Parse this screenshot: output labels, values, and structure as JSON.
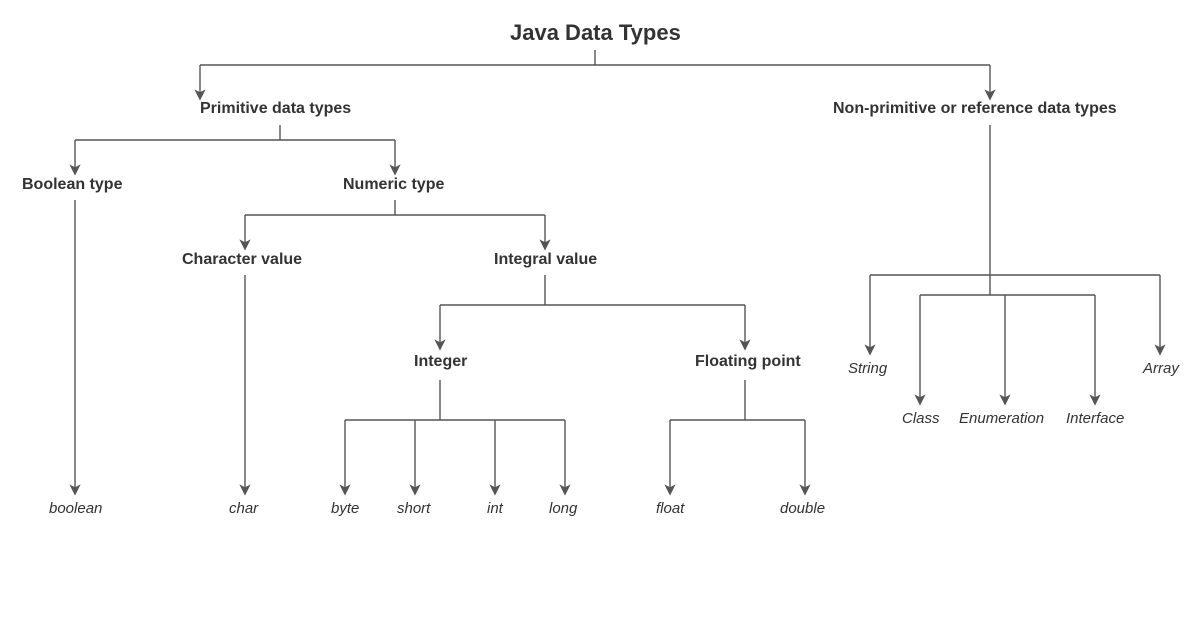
{
  "title": "Java Data Types",
  "tree": {
    "primitive": {
      "label": "Primitive data types",
      "boolean_type": {
        "label": "Boolean type",
        "boolean": "boolean"
      },
      "numeric_type": {
        "label": "Numeric type",
        "character_value": {
          "label": "Character value",
          "char": "char"
        },
        "integral_value": {
          "label": "Integral value",
          "integer": {
            "label": "Integer",
            "byte": "byte",
            "short": "short",
            "int": "int",
            "long": "long"
          },
          "floating_point": {
            "label": "Floating point",
            "float": "float",
            "double": "double"
          }
        }
      }
    },
    "nonprimitive": {
      "label": "Non-primitive or reference data types",
      "string": "String",
      "class": "Class",
      "enumeration": "Enumeration",
      "interface": "Interface",
      "array": "Array"
    }
  }
}
